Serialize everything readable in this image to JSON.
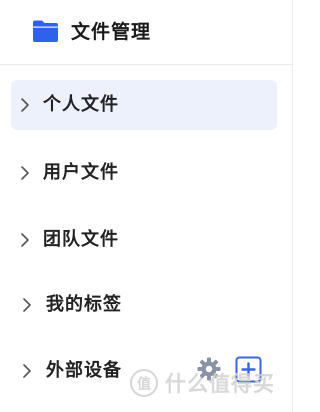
{
  "header": {
    "title": "文件管理",
    "icon": "folder-icon",
    "icon_color": "#2f62e8"
  },
  "nav": {
    "items": [
      {
        "label": "个人文件",
        "active": true
      },
      {
        "label": "用户文件",
        "active": false
      },
      {
        "label": "团队文件",
        "active": false
      },
      {
        "label": "我的标签",
        "active": false
      },
      {
        "label": "外部设备",
        "active": false
      }
    ]
  },
  "actions": {
    "settings_icon": "gear-icon",
    "add_icon": "add-icon",
    "accent_color": "#3a64e0",
    "gear_color": "#8a93a6"
  },
  "watermark": {
    "text": "什么值得买",
    "logo": "值"
  },
  "colors": {
    "active_bg": "#edf1fc",
    "divider": "#e9e9e9"
  }
}
